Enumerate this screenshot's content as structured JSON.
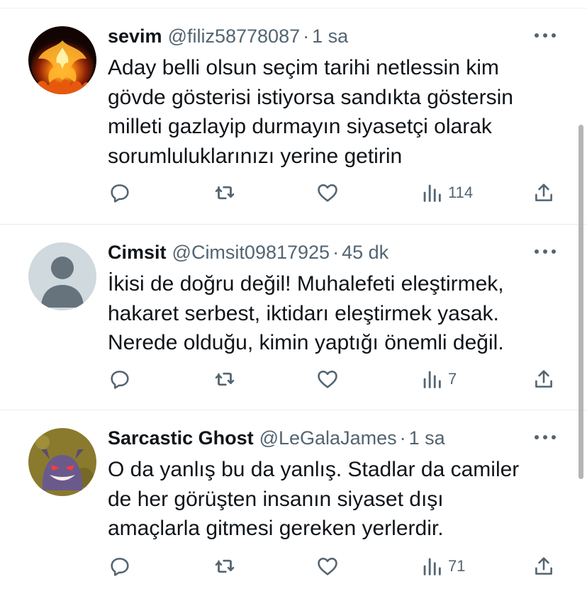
{
  "tweets": [
    {
      "display_name": "sevim",
      "handle": "@filiz58778087",
      "separator": "·",
      "time": "1 sa",
      "text": "Aday belli olsun seçim tarihi netlessin kim\ngövde gösterisi istiyorsa sandıkta göstersin\nmilleti gazlayip durmayın siyasetçi olarak\nsorumluluklarınızı yerine getirin",
      "views": "114",
      "avatar": "phoenix-fire"
    },
    {
      "display_name": "Cimsit",
      "handle": "@Cimsit09817925",
      "separator": "·",
      "time": "45 dk",
      "text": "İkisi de doğru değil! Muhalefeti eleştirmek,\nhakaret serbest, iktidarı eleştirmek yasak.\nNerede olduğu, kimin yaptığı önemli değil.",
      "views": "7",
      "avatar": "default-person"
    },
    {
      "display_name": "Sarcastic Ghost",
      "handle": "@LeGalaJames",
      "separator": "·",
      "time": "1 sa",
      "text": "O da yanlış bu da yanlış. Stadlar da camiler\nde her görüşten insanın siyaset dışı\namaçlarla gitmesi gereken yerlerdir.",
      "views": "71",
      "avatar": "gengar-character"
    }
  ],
  "icons": {
    "reply": "reply-icon",
    "retweet": "retweet-icon",
    "like": "heart-icon",
    "views": "views-icon",
    "share": "share-icon",
    "more": "more-dots-icon"
  },
  "colors": {
    "text_primary": "#0f1419",
    "text_secondary": "#536471",
    "divider": "#e7ecee",
    "avatar_default_bg": "#cfd9de"
  }
}
